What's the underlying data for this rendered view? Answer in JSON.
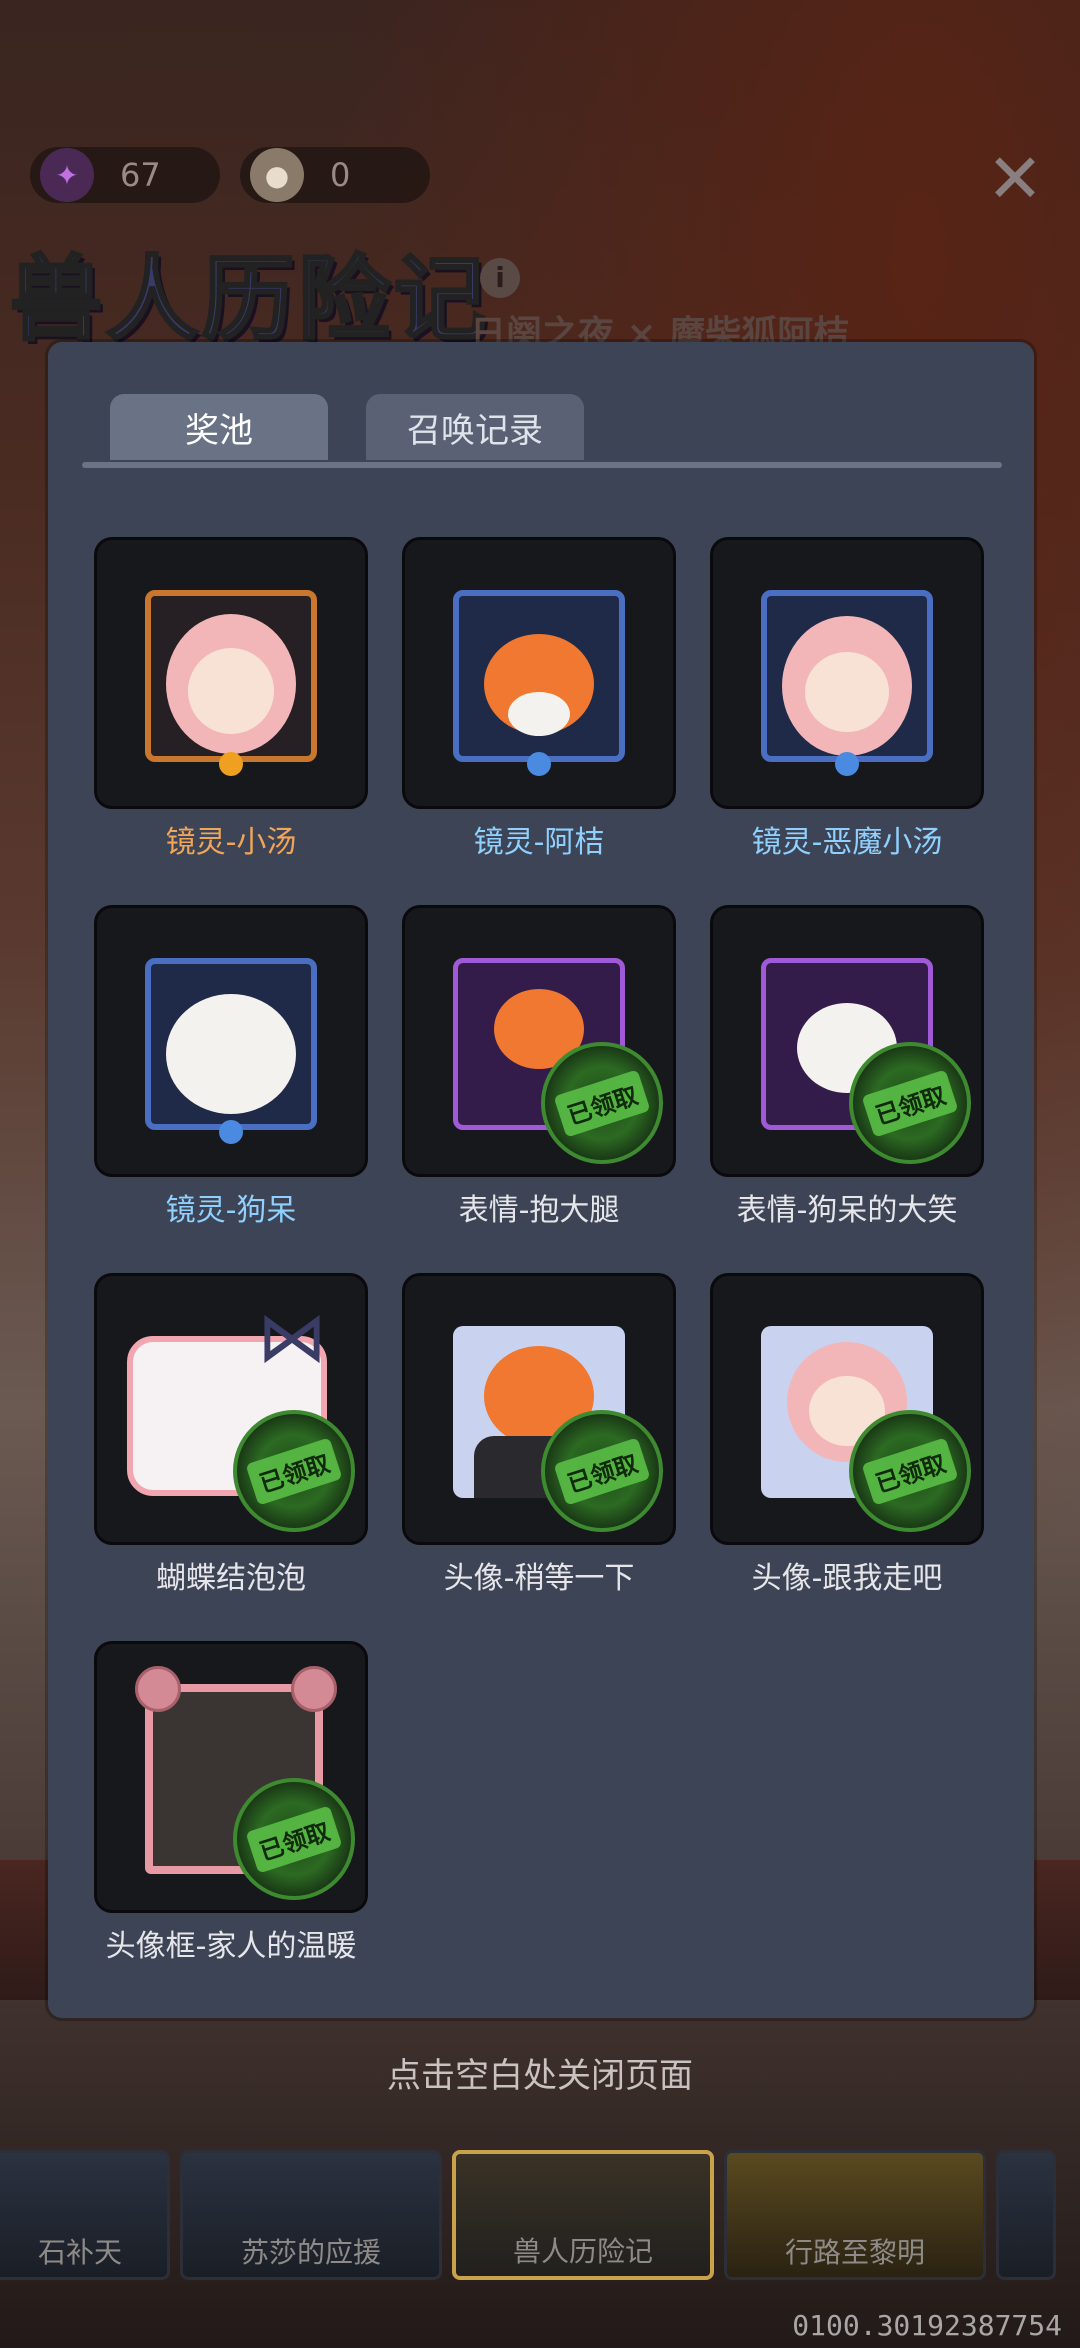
{
  "header": {
    "candy_count": "67",
    "bun_count": "0",
    "title": "兽人历险记",
    "subtitle": "日阕之夜 × 魔柴狐阿桔"
  },
  "modal": {
    "tabs": [
      {
        "label": "奖池",
        "active": true
      },
      {
        "label": "召唤记录",
        "active": false
      }
    ],
    "claimed_label": "已领取",
    "items": [
      {
        "label": "镜灵-小汤",
        "claimed": false
      },
      {
        "label": "镜灵-阿桔",
        "claimed": false
      },
      {
        "label": "镜灵-恶魔小汤",
        "claimed": false
      },
      {
        "label": "镜灵-狗呆",
        "claimed": false
      },
      {
        "label": "表情-抱大腿",
        "claimed": true
      },
      {
        "label": "表情-狗呆的大笑",
        "claimed": true
      },
      {
        "label": "蝴蝶结泡泡",
        "claimed": true
      },
      {
        "label": "头像-稍等一下",
        "claimed": true
      },
      {
        "label": "头像-跟我走吧",
        "claimed": true
      },
      {
        "label": "头像框-家人的温暖",
        "claimed": true
      }
    ]
  },
  "footer": {
    "hint": "点击空白处关闭页面",
    "banners": [
      "石补天",
      "苏莎的应援",
      "兽人历险记",
      "行路至黎明"
    ],
    "version": "0100.30192387754"
  },
  "colors": {
    "modal_bg": "#3d4455",
    "rarity_orange": "#f0a558",
    "rarity_blue": "#8fd0ff",
    "claimed_green": "#3e8a30"
  }
}
